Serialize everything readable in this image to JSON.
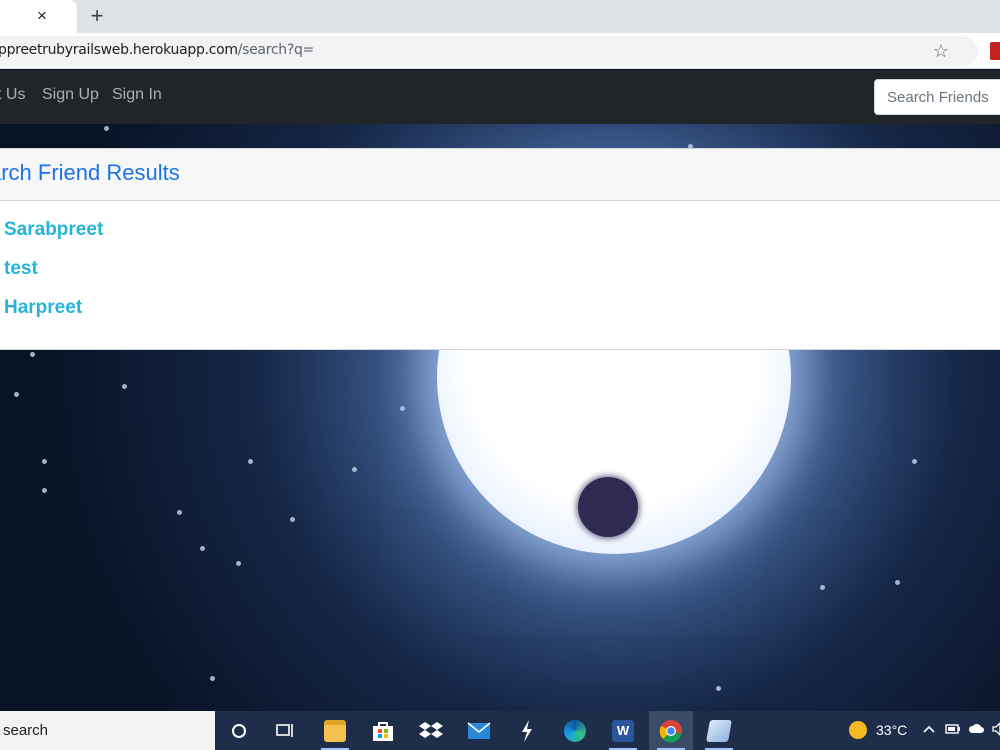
{
  "browser": {
    "tab_close": "×",
    "new_tab": "+",
    "url_host": "ppreetrubyrailsweb.herokuapp.com",
    "url_path": "/search?q=",
    "bookmark_star": "☆"
  },
  "navbar": {
    "links": [
      "t Us",
      "Sign Up",
      "Sign In"
    ],
    "search_placeholder": "Search Friends"
  },
  "results": {
    "title": "arch Friend Results",
    "items": [
      "Sarabpreet",
      "test",
      "Harpreet"
    ]
  },
  "taskbar": {
    "search_text": "search",
    "temperature": "33°C",
    "icons": [
      "cortana-icon",
      "task-view-icon",
      "file-explorer-icon",
      "store-icon",
      "dropbox-icon",
      "mail-icon",
      "app-icon",
      "edge-icon",
      "word-icon",
      "chrome-icon",
      "notepad-icon"
    ]
  },
  "colors": {
    "navbar": "#212529",
    "title": "#1a73e8",
    "result_link": "#26b5d9",
    "taskbar": "#1d2d4a"
  }
}
